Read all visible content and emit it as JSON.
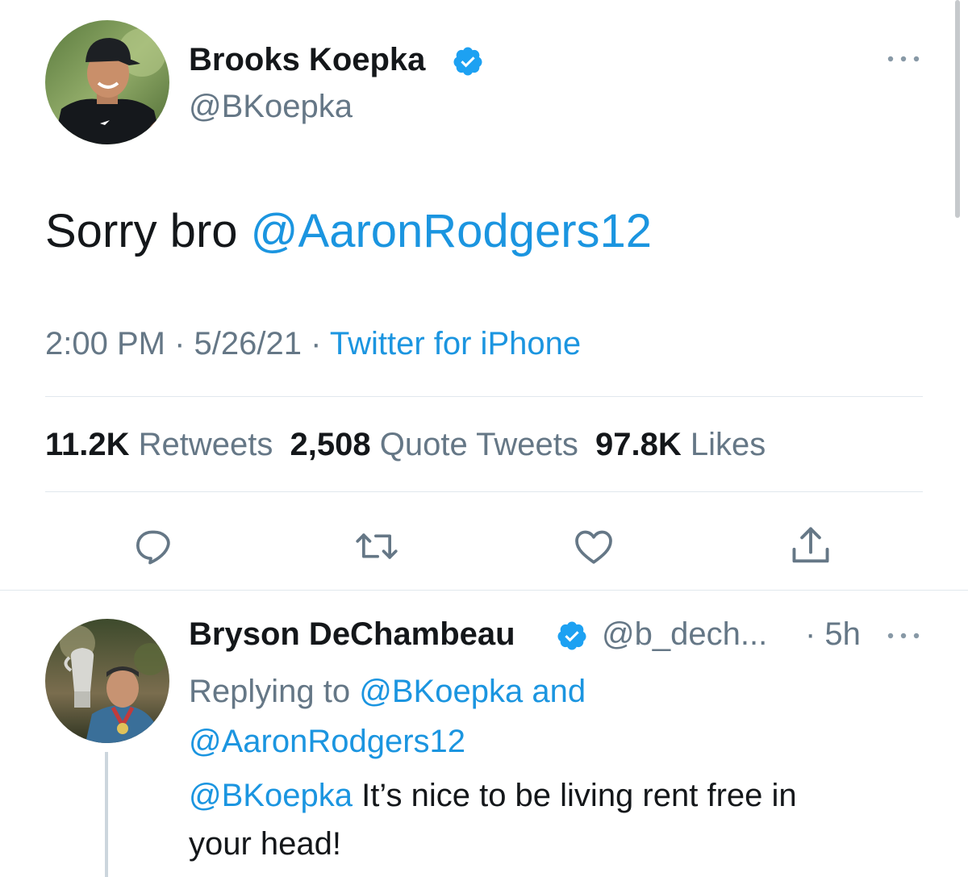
{
  "main_tweet": {
    "author_name": "Brooks Koepka",
    "author_handle": "@BKoepka",
    "text_plain": "Sorry bro",
    "text_mention": "@AaronRodgers12",
    "time": "2:00 PM",
    "sep1": "·",
    "date": "5/26/21",
    "sep2": "·",
    "source": "Twitter for iPhone",
    "stats": {
      "retweets_count": "11.2K",
      "retweets_label": "Retweets",
      "quotes_count": "2,508",
      "quotes_label": "Quote Tweets",
      "likes_count": "97.8K",
      "likes_label": "Likes"
    },
    "more_icon": "ellipsis-icon",
    "verified_icon": "verified-badge-icon"
  },
  "actions": [
    "reply-icon",
    "retweet-icon",
    "like-icon",
    "share-icon"
  ],
  "reply_tweet": {
    "author_name": "Bryson DeChambeau",
    "author_handle": "@b_dech...",
    "time_ago": "· 5h",
    "replying_prefix": "Replying to",
    "replying_user1": "@BKoepka",
    "replying_and": "and",
    "replying_user2": "@AaronRodgers12",
    "text_mention": "@BKoepka",
    "text_line1": "It’s nice to be living rent free in",
    "text_line2": "your head!"
  },
  "colors": {
    "accent": "#1b95e0",
    "text": "#14171a",
    "secondary": "#657786",
    "divider": "#e1e8ed"
  }
}
